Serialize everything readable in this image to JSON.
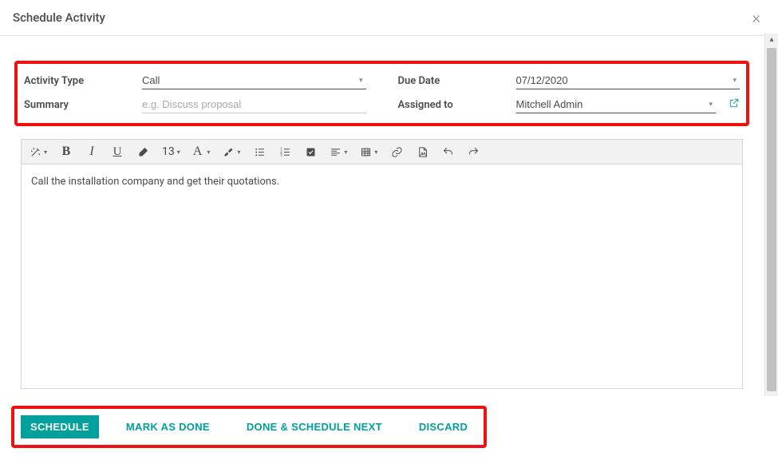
{
  "header": {
    "title": "Schedule Activity"
  },
  "form": {
    "activity_type": {
      "label": "Activity Type",
      "value": "Call"
    },
    "summary": {
      "label": "Summary",
      "placeholder": "e.g. Discuss proposal",
      "value": ""
    },
    "due_date": {
      "label": "Due Date",
      "value": "07/12/2020"
    },
    "assigned_to": {
      "label": "Assigned to",
      "value": "Mitchell Admin"
    }
  },
  "toolbar": {
    "font_size": "13"
  },
  "editor": {
    "body": "Call the installation company and get their quotations."
  },
  "footer": {
    "schedule": "SCHEDULE",
    "mark_done": "MARK AS DONE",
    "done_next": "DONE & SCHEDULE NEXT",
    "discard": "DISCARD"
  }
}
